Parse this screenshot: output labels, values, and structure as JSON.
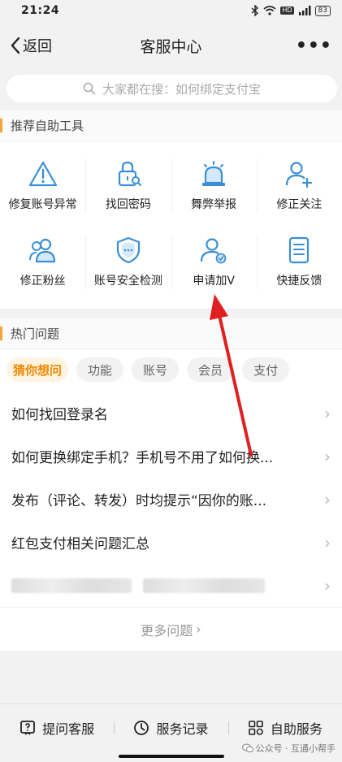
{
  "status_bar": {
    "time": "21:24",
    "battery": "83",
    "network_badge": "HD"
  },
  "nav": {
    "back_label": "返回",
    "title": "客服中心",
    "more_label": "•••"
  },
  "search": {
    "placeholder": "大家都在搜：如何绑定支付宝"
  },
  "tools_section": {
    "title": "推荐自助工具",
    "rows": [
      [
        {
          "label": "修复账号异常",
          "icon": "warning-triangle-icon"
        },
        {
          "label": "找回密码",
          "icon": "lock-search-icon"
        },
        {
          "label": "舞弊举报",
          "icon": "siren-icon"
        },
        {
          "label": "修正关注",
          "icon": "user-add-icon"
        }
      ],
      [
        {
          "label": "修正粉丝",
          "icon": "users-icon"
        },
        {
          "label": "账号安全检测",
          "icon": "shield-icon"
        },
        {
          "label": "申请加V",
          "icon": "user-verified-icon"
        },
        {
          "label": "快捷反馈",
          "icon": "document-list-icon"
        }
      ]
    ]
  },
  "hot_section": {
    "title": "热门问题",
    "chips": [
      "猜你想问",
      "功能",
      "账号",
      "会员",
      "支付"
    ],
    "active_chip": 0,
    "questions": [
      "如何找回登录名",
      "如何更换绑定手机？手机号不用了如何换...",
      "发布（评论、转发）时均提示“因你的账...",
      "红包支付相关问题汇总"
    ],
    "more_label": "更多问题"
  },
  "bottom_bar": {
    "items": [
      {
        "label": "提问客服",
        "icon": "question-box-icon"
      },
      {
        "label": "服务记录",
        "icon": "clock-icon"
      },
      {
        "label": "自助服务",
        "icon": "grid-icon"
      }
    ]
  },
  "watermark": {
    "text": "公众号 · 互通小帮手"
  },
  "colors": {
    "accent": "#f7a233",
    "icon_blue": "#3a8fd6",
    "annotation_arrow": "#e02020"
  }
}
